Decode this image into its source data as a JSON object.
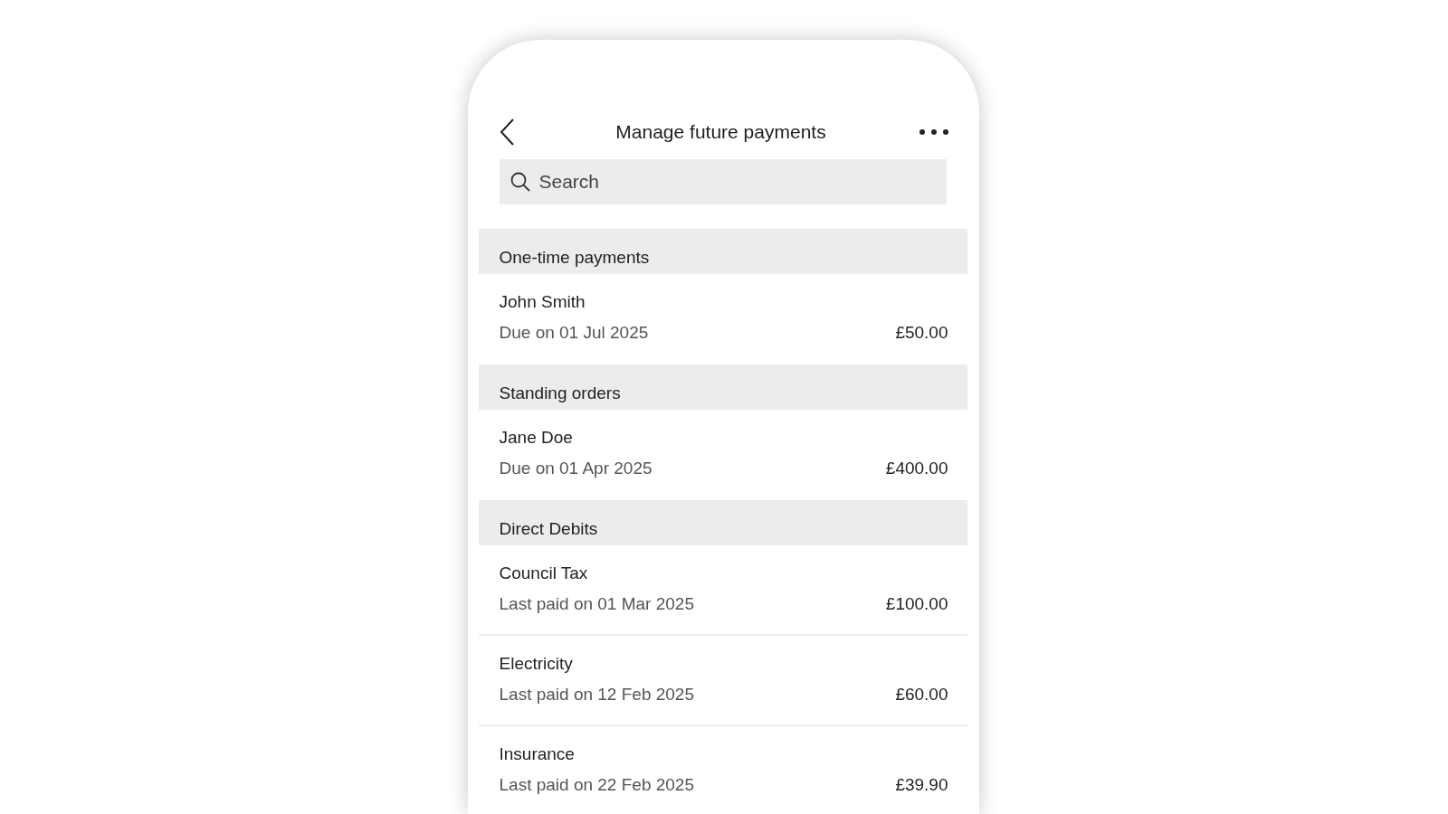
{
  "header": {
    "title": "Manage future payments"
  },
  "search": {
    "placeholder": "Search"
  },
  "sections": [
    {
      "title": "One-time payments",
      "items": [
        {
          "name": "John Smith",
          "detail": "Due on 01 Jul 2025",
          "amount": "£50.00"
        }
      ]
    },
    {
      "title": "Standing orders",
      "items": [
        {
          "name": "Jane Doe",
          "detail": "Due on 01 Apr 2025",
          "amount": "£400.00"
        }
      ]
    },
    {
      "title": "Direct Debits",
      "items": [
        {
          "name": "Council Tax",
          "detail": "Last paid on 01 Mar 2025",
          "amount": "£100.00"
        },
        {
          "name": "Electricity",
          "detail": "Last paid on 12 Feb 2025",
          "amount": "£60.00"
        },
        {
          "name": "Insurance",
          "detail": "Last paid on 22 Feb 2025",
          "amount": "£39.90"
        }
      ]
    }
  ]
}
